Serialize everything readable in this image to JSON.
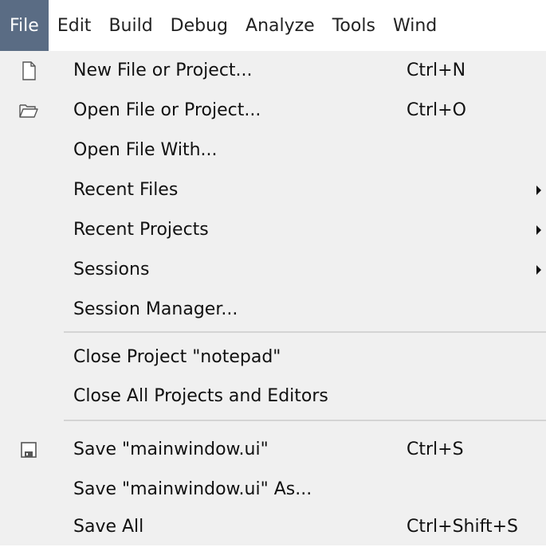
{
  "menubar": {
    "items": [
      {
        "label": "File",
        "active": true
      },
      {
        "label": "Edit"
      },
      {
        "label": "Build"
      },
      {
        "label": "Debug"
      },
      {
        "label": "Analyze"
      },
      {
        "label": "Tools"
      },
      {
        "label": "Wind"
      }
    ]
  },
  "file_menu": {
    "items": [
      {
        "label": "New File or Project...",
        "shortcut": "Ctrl+N",
        "icon": "new-file-icon"
      },
      {
        "label": "Open File or Project...",
        "shortcut": "Ctrl+O",
        "icon": "open-folder-icon"
      },
      {
        "label": "Open File With...",
        "shortcut": ""
      },
      {
        "label": "Recent Files",
        "submenu": true
      },
      {
        "label": "Recent Projects",
        "submenu": true
      },
      {
        "label": "Sessions",
        "submenu": true
      },
      {
        "label": "Session Manager..."
      },
      {
        "label": "Close Project \"notepad\""
      },
      {
        "label": "Close All Projects and Editors"
      },
      {
        "label": "Save \"mainwindow.ui\"",
        "shortcut": "Ctrl+S",
        "icon": "save-icon"
      },
      {
        "label": "Save \"mainwindow.ui\" As..."
      },
      {
        "label": "Save All",
        "shortcut": "Ctrl+Shift+S"
      }
    ]
  },
  "colors": {
    "menubar_active_bg": "#5a6c84",
    "menu_bg": "#f0f0f0",
    "separator": "#d4d4d4"
  }
}
